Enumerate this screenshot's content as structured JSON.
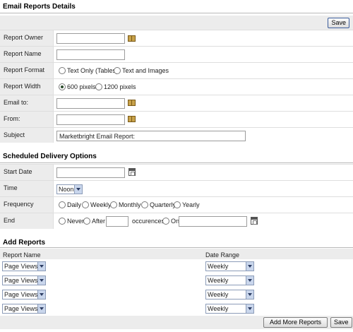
{
  "email_details": {
    "title": "Email Reports Details",
    "save_label": "Save",
    "report_owner": {
      "label": "Report Owner",
      "value": ""
    },
    "report_name": {
      "label": "Report Name",
      "value": ""
    },
    "report_format": {
      "label": "Report Format",
      "options": [
        "Text Only (Tables)",
        "Text and Images"
      ],
      "selected": null
    },
    "report_width": {
      "label": "Report Width",
      "options": [
        "600 pixels",
        "1200 pixels"
      ],
      "selected": "600 pixels"
    },
    "email_to": {
      "label": "Email to:",
      "value": ""
    },
    "from": {
      "label": "From:",
      "value": ""
    },
    "subject": {
      "label": "Subject",
      "value": "Marketbright Email Report:"
    }
  },
  "delivery": {
    "title": "Scheduled Delivery Options",
    "start_date": {
      "label": "Start Date",
      "value": ""
    },
    "time": {
      "label": "Time",
      "value": "Noon"
    },
    "frequency": {
      "label": "Frequency",
      "options": [
        "Daily",
        "Weekly",
        "Monthly",
        "Quarterly",
        "Yearly"
      ],
      "selected": null
    },
    "end": {
      "label": "End",
      "never": "Never",
      "after": "After",
      "occurences": "occurences",
      "on": "On",
      "after_value": "",
      "on_value": ""
    }
  },
  "add_reports": {
    "title": "Add Reports",
    "columns": [
      "Report Name",
      "Date Range"
    ],
    "rows": [
      {
        "report": "Page Views",
        "range": "Weekly"
      },
      {
        "report": "Page Views",
        "range": "Weekly"
      },
      {
        "report": "Page Views",
        "range": "Weekly"
      },
      {
        "report": "Page Views",
        "range": "Weekly"
      }
    ],
    "add_more_label": "Add More Reports",
    "save_label": "Save"
  },
  "icons": {
    "address_book": "address-book-icon",
    "calendar": "calendar-icon",
    "dropdown": "chevron-down-icon"
  }
}
